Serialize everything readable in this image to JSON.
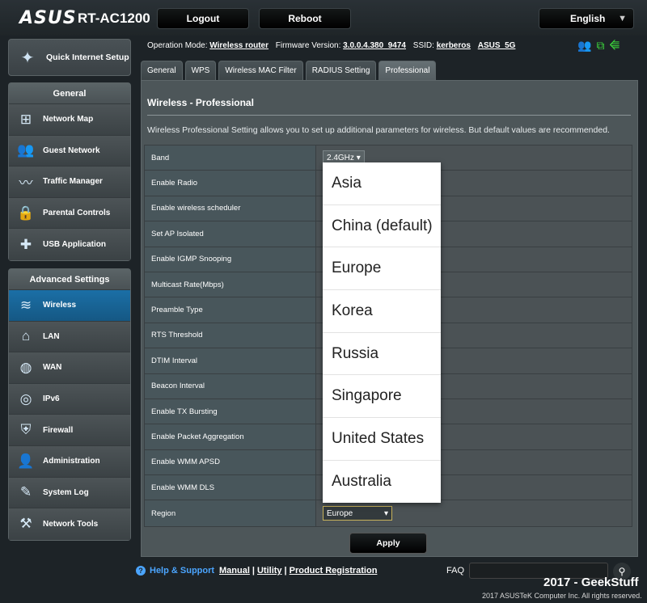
{
  "header": {
    "brand": "ASUS",
    "model": "RT-AC1200",
    "logout": "Logout",
    "reboot": "Reboot",
    "language": "English"
  },
  "status": {
    "op_mode_label": "Operation Mode:",
    "op_mode": "Wireless router",
    "fw_label": "Firmware Version:",
    "fw": "3.0.0.4.380_9474",
    "ssid_label": "SSID:",
    "ssid1": "kerberos",
    "ssid2": "ASUS_5G"
  },
  "sidebar": {
    "qis": "Quick Internet Setup",
    "general_head": "General",
    "general": [
      {
        "label": "Network Map",
        "icon": "network-map-icon"
      },
      {
        "label": "Guest Network",
        "icon": "guest-network-icon"
      },
      {
        "label": "Traffic Manager",
        "icon": "traffic-manager-icon"
      },
      {
        "label": "Parental Controls",
        "icon": "parental-controls-icon"
      },
      {
        "label": "USB Application",
        "icon": "usb-application-icon"
      }
    ],
    "advanced_head": "Advanced Settings",
    "advanced": [
      {
        "label": "Wireless",
        "icon": "wireless-icon"
      },
      {
        "label": "LAN",
        "icon": "lan-icon"
      },
      {
        "label": "WAN",
        "icon": "wan-icon"
      },
      {
        "label": "IPv6",
        "icon": "ipv6-icon"
      },
      {
        "label": "Firewall",
        "icon": "firewall-icon"
      },
      {
        "label": "Administration",
        "icon": "administration-icon"
      },
      {
        "label": "System Log",
        "icon": "system-log-icon"
      },
      {
        "label": "Network Tools",
        "icon": "network-tools-icon"
      }
    ]
  },
  "tabs": [
    "General",
    "WPS",
    "Wireless MAC Filter",
    "RADIUS Setting",
    "Professional"
  ],
  "page": {
    "title": "Wireless - Professional",
    "description": "Wireless Professional Setting allows you to set up additional parameters for wireless. But default values are recommended.",
    "apply": "Apply"
  },
  "settings": {
    "band_label": "Band",
    "band_value": "2.4GHz",
    "rows": [
      "Enable Radio",
      "Enable wireless scheduler",
      "Set AP Isolated",
      "Enable IGMP Snooping",
      "Multicast Rate(Mbps)",
      "Preamble Type",
      "RTS Threshold",
      "DTIM Interval",
      "Beacon Interval",
      "Enable TX Bursting",
      "Enable Packet Aggregation",
      "Enable WMM APSD",
      "Enable WMM DLS"
    ],
    "region_label": "Region",
    "region_value": "Europe"
  },
  "region_options": [
    "Asia",
    "China (default)",
    "Europe",
    "Korea",
    "Russia",
    "Singapore",
    "United States",
    "Australia"
  ],
  "footer": {
    "help": "Help & Support",
    "manual": "Manual",
    "utility": "Utility",
    "registration": "Product Registration",
    "faq": "FAQ",
    "watermark": "2017 - GeekStuff",
    "copyright": "2017 ASUSTeK Computer Inc. All rights reserved."
  }
}
